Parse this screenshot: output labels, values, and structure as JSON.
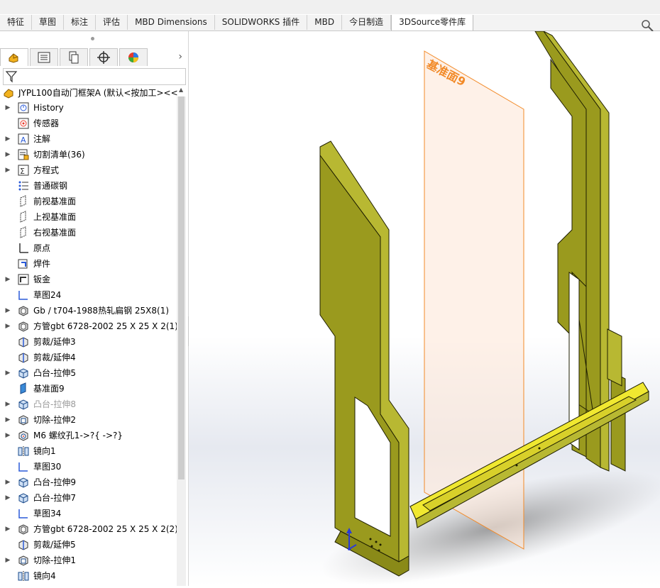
{
  "tabs": [
    {
      "label": "特征",
      "active": false
    },
    {
      "label": "草图",
      "active": false
    },
    {
      "label": "标注",
      "active": false
    },
    {
      "label": "评估",
      "active": false
    },
    {
      "label": "MBD Dimensions",
      "active": false
    },
    {
      "label": "SOLIDWORKS 插件",
      "active": false
    },
    {
      "label": "MBD",
      "active": false
    },
    {
      "label": "今日制造",
      "active": false
    },
    {
      "label": "3DSource零件库",
      "active": true
    }
  ],
  "panel": {
    "manager_tabs": [
      "feature-manager-icon",
      "property-manager-icon",
      "configuration-manager-icon",
      "dimxpert-icon",
      "display-manager-icon"
    ],
    "root_label": "JYPL100自动门框架A  (默认<按加工><<",
    "tree": [
      {
        "label": "History",
        "icon": "history-icon",
        "expand": true,
        "dim": false
      },
      {
        "label": "传感器",
        "icon": "sensor-icon",
        "expand": false,
        "dim": false
      },
      {
        "label": "注解",
        "icon": "annotation-icon",
        "expand": true,
        "dim": false
      },
      {
        "label": "切割清单(36)",
        "icon": "cutlist-icon",
        "expand": true,
        "dim": false
      },
      {
        "label": "方程式",
        "icon": "equation-icon",
        "expand": true,
        "dim": false
      },
      {
        "label": "普通碳钢",
        "icon": "material-icon",
        "expand": false,
        "dim": false
      },
      {
        "label": "前视基准面",
        "icon": "plane-icon",
        "expand": false,
        "dim": false
      },
      {
        "label": "上视基准面",
        "icon": "plane-icon",
        "expand": false,
        "dim": false
      },
      {
        "label": "右视基准面",
        "icon": "plane-icon",
        "expand": false,
        "dim": false
      },
      {
        "label": "原点",
        "icon": "origin-icon",
        "expand": false,
        "dim": false
      },
      {
        "label": "焊件",
        "icon": "weldment-icon",
        "expand": false,
        "dim": false
      },
      {
        "label": "钣金",
        "icon": "sheetmetal-icon",
        "expand": true,
        "dim": false
      },
      {
        "label": "草图24",
        "icon": "sketch-icon",
        "expand": false,
        "dim": false
      },
      {
        "label": "Gb / t704-1988热轧扁钢 25X8(1)",
        "icon": "structural-member-icon",
        "expand": true,
        "dim": false
      },
      {
        "label": "方管gbt 6728-2002 25 X 25 X 2(1)",
        "icon": "structural-member-icon",
        "expand": true,
        "dim": false
      },
      {
        "label": "剪裁/延伸3",
        "icon": "trim-extend-icon",
        "expand": false,
        "dim": false
      },
      {
        "label": "剪裁/延伸4",
        "icon": "trim-extend-icon",
        "expand": false,
        "dim": false
      },
      {
        "label": "凸台-拉伸5",
        "icon": "boss-extrude-icon",
        "expand": true,
        "dim": false
      },
      {
        "label": "基准面9",
        "icon": "plane-filled-icon",
        "expand": false,
        "dim": false
      },
      {
        "label": "凸台-拉伸8",
        "icon": "boss-extrude-icon",
        "expand": true,
        "dim": true
      },
      {
        "label": "切除-拉伸2",
        "icon": "cut-extrude-icon",
        "expand": true,
        "dim": false
      },
      {
        "label": "M6 螺纹孔1->?{ ->?}",
        "icon": "hole-wizard-icon",
        "expand": true,
        "dim": false
      },
      {
        "label": "镜向1",
        "icon": "mirror-icon",
        "expand": false,
        "dim": false
      },
      {
        "label": "草图30",
        "icon": "sketch-icon",
        "expand": false,
        "dim": false
      },
      {
        "label": "凸台-拉伸9",
        "icon": "boss-extrude-icon",
        "expand": true,
        "dim": false
      },
      {
        "label": "凸台-拉伸7",
        "icon": "boss-extrude-icon",
        "expand": true,
        "dim": false
      },
      {
        "label": "草图34",
        "icon": "sketch-icon",
        "expand": false,
        "dim": false
      },
      {
        "label": "方管gbt 6728-2002 25 X 25 X 2(2)",
        "icon": "structural-member-icon",
        "expand": true,
        "dim": false
      },
      {
        "label": "剪裁/延伸5",
        "icon": "trim-extend-icon",
        "expand": false,
        "dim": false
      },
      {
        "label": "切除-拉伸1",
        "icon": "cut-extrude-icon",
        "expand": true,
        "dim": false
      },
      {
        "label": "镜向4",
        "icon": "mirror-icon",
        "expand": false,
        "dim": false
      }
    ]
  },
  "viewport": {
    "plane_label": "基准面9",
    "colors": {
      "part": "#9a9a1e",
      "part_light": "#b8b832",
      "edge": "#1e1e00",
      "plane": "#f28a28",
      "bar_highlight": "#f0e830"
    }
  }
}
